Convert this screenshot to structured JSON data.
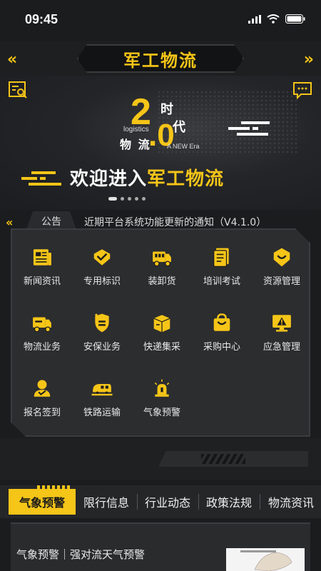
{
  "status": {
    "time": "09:45"
  },
  "header": {
    "title": "军工物流"
  },
  "banner": {
    "big_num": "2",
    "dot_zero": ".0",
    "shi": "时",
    "dai": "代",
    "logistics": "logistics",
    "wuliu": "物 流",
    "new_era": "A NEW Era",
    "welcome_prefix": "欢迎进入",
    "welcome_highlight": "军工物流",
    "carousel_total": 5,
    "carousel_active": 1
  },
  "notice": {
    "tag": "公告",
    "text": "近期平台系统功能更新的通知（V4.1.0）"
  },
  "grid": {
    "items": [
      {
        "label": "新闻资讯",
        "icon": "newspaper-icon"
      },
      {
        "label": "专用标识",
        "icon": "mark-icon"
      },
      {
        "label": "装卸货",
        "icon": "truck-loading-icon"
      },
      {
        "label": "培训考试",
        "icon": "exam-icon"
      },
      {
        "label": "资源管理",
        "icon": "shield-check-icon"
      },
      {
        "label": "物流业务",
        "icon": "truck-icon"
      },
      {
        "label": "安保业务",
        "icon": "security-icon"
      },
      {
        "label": "快递集采",
        "icon": "package-icon"
      },
      {
        "label": "采购中心",
        "icon": "shopping-bag-icon"
      },
      {
        "label": "应急管理",
        "icon": "alert-monitor-icon"
      },
      {
        "label": "报名签到",
        "icon": "user-group-icon"
      },
      {
        "label": "铁路运输",
        "icon": "train-icon"
      },
      {
        "label": "气象预警",
        "icon": "siren-icon"
      }
    ]
  },
  "tabs": {
    "items": [
      "气象预警",
      "限行信息",
      "行业动态",
      "政策法规",
      "物流资讯"
    ],
    "active": 0
  },
  "news": {
    "title": "气象预警｜强对流天气预警"
  },
  "colors": {
    "accent": "#f5c518",
    "background": "#1b1c1e",
    "panel": "#2c2d2f"
  }
}
